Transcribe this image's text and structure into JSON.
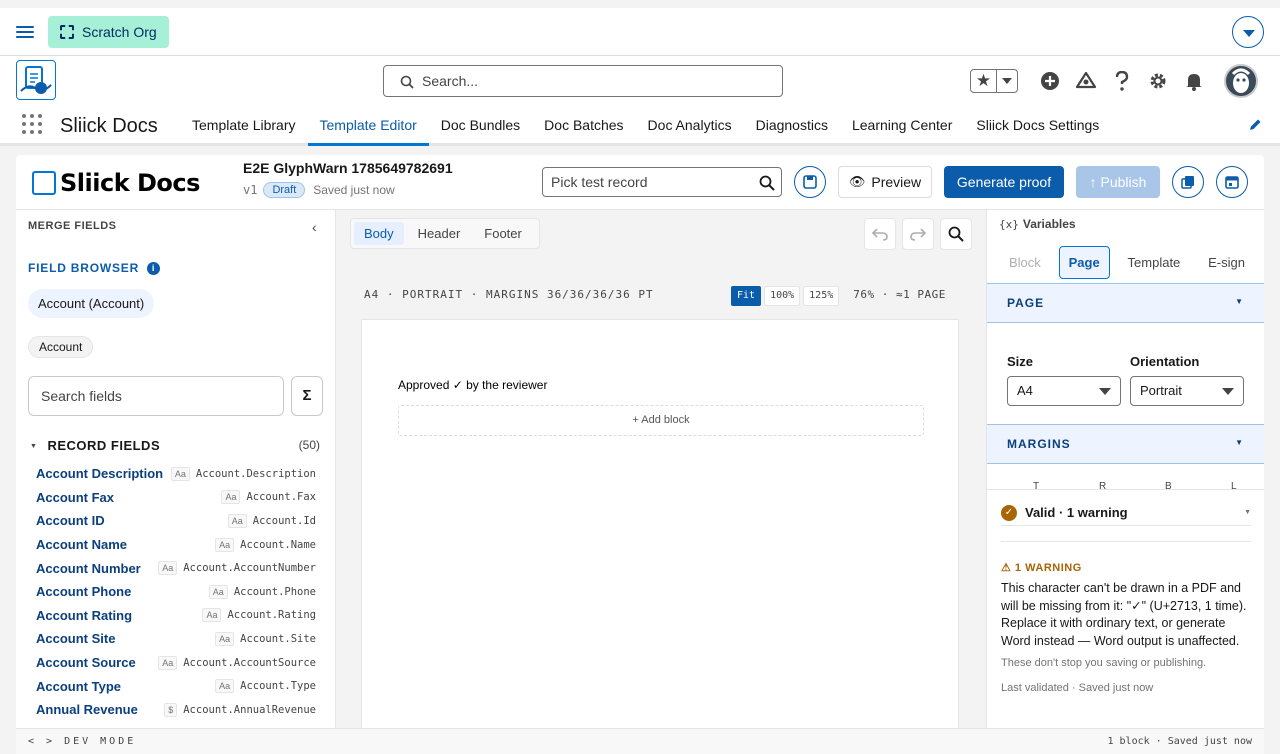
{
  "org": {
    "name": "Scratch Org"
  },
  "global": {
    "search_placeholder": "Search..."
  },
  "nav": {
    "app_name": "Sliick Docs",
    "tabs": [
      {
        "label": "Template Library"
      },
      {
        "label": "Template Editor",
        "active": true
      },
      {
        "label": "Doc Bundles"
      },
      {
        "label": "Doc Batches"
      },
      {
        "label": "Doc Analytics"
      },
      {
        "label": "Diagnostics"
      },
      {
        "label": "Learning Center"
      },
      {
        "label": "Sliick Docs Settings"
      }
    ]
  },
  "editor": {
    "brand": "Sliick Docs",
    "title": "E2E GlyphWarn 1785649782691",
    "version": "v1",
    "status": "Draft",
    "saved": "Saved just now",
    "test_record_placeholder": "Pick test record",
    "preview_label": "Preview",
    "generate_label": "Generate proof",
    "publish_label": "↑ Publish"
  },
  "left": {
    "header": "MERGE FIELDS",
    "browser_title": "FIELD BROWSER",
    "object_pill": "Account (Account)",
    "object_chip": "Account",
    "search_placeholder": "Search fields",
    "sigma": "Σ",
    "record_fields_title": "RECORD FIELDS",
    "record_fields_count": "(50)",
    "fields": [
      {
        "label": "Account Description",
        "type": "Aa",
        "api": "Account.Description"
      },
      {
        "label": "Account Fax",
        "type": "Aa",
        "api": "Account.Fax"
      },
      {
        "label": "Account ID",
        "type": "Aa",
        "api": "Account.Id"
      },
      {
        "label": "Account Name",
        "type": "Aa",
        "api": "Account.Name"
      },
      {
        "label": "Account Number",
        "type": "Aa",
        "api": "Account.AccountNumber"
      },
      {
        "label": "Account Phone",
        "type": "Aa",
        "api": "Account.Phone"
      },
      {
        "label": "Account Rating",
        "type": "Aa",
        "api": "Account.Rating"
      },
      {
        "label": "Account Site",
        "type": "Aa",
        "api": "Account.Site"
      },
      {
        "label": "Account Source",
        "type": "Aa",
        "api": "Account.AccountSource"
      },
      {
        "label": "Account Type",
        "type": "Aa",
        "api": "Account.Type"
      },
      {
        "label": "Annual Revenue",
        "type": "$",
        "api": "Account.AnnualRevenue"
      }
    ]
  },
  "center": {
    "tabs": [
      {
        "label": "Body",
        "active": true
      },
      {
        "label": "Header"
      },
      {
        "label": "Footer"
      }
    ],
    "page_info": "A4 · PORTRAIT · MARGINS 36/36/36/36 PT",
    "zoom_options": [
      {
        "label": "Fit",
        "active": true
      },
      {
        "label": "100%"
      },
      {
        "label": "125%"
      }
    ],
    "zoom_info": "76% · ≈1 PAGE",
    "paragraph": "Approved ✓ by the reviewer",
    "add_block": "+ Add block"
  },
  "right": {
    "variables_prefix": "{x}",
    "variables_label": "Variables",
    "tabs": [
      {
        "label": "Block",
        "disabled": true
      },
      {
        "label": "Page",
        "active": true
      },
      {
        "label": "Template"
      },
      {
        "label": "E-sign"
      }
    ],
    "page_section": "PAGE",
    "size_label": "Size",
    "size_value": "A4",
    "orientation_label": "Orientation",
    "orientation_value": "Portrait",
    "margins_section": "MARGINS",
    "margin_letters": [
      "T",
      "R",
      "B",
      "L"
    ],
    "validity": "Valid · 1 warning",
    "warning_title": "1 WARNING",
    "warning_body": "This character can't be drawn in a PDF and will be missing from it: \"✓\" (U+2713, 1 time). Replace it with ordinary text, or generate Word instead — Word output is unaffected.",
    "warning_note": "These don't stop you saving or publishing.",
    "warning_footer": "Last validated · Saved just now"
  },
  "status": {
    "left": "< > DEV MODE",
    "right": "1 block · Saved just now"
  },
  "colors": {
    "brand": "#0176d3",
    "primary_button": "#0b5cab",
    "warning": "#a96404",
    "org_pill": "#a7f0d8"
  }
}
